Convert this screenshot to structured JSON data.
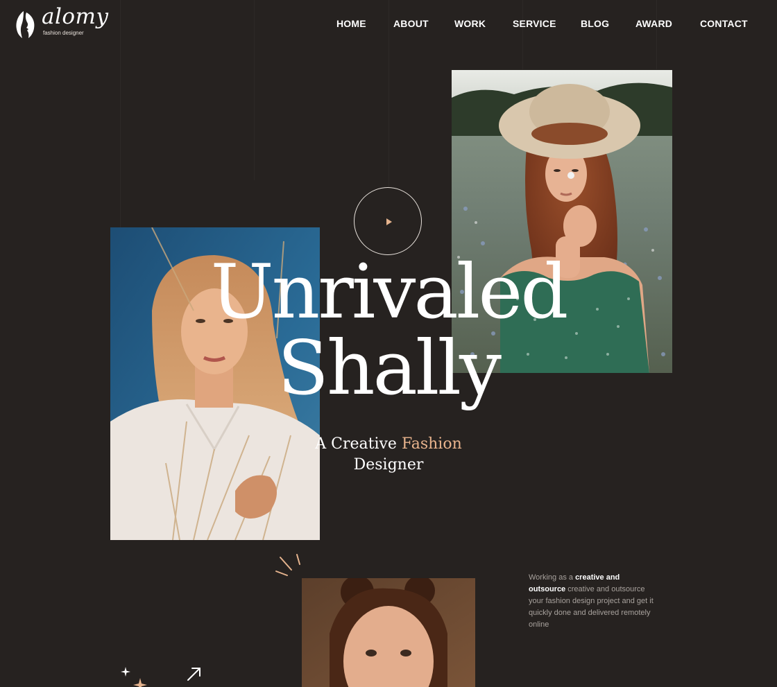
{
  "brand": {
    "name": "alomy",
    "tagline": "fashion designer"
  },
  "nav": {
    "items": [
      {
        "label": "HOME"
      },
      {
        "label": "ABOUT"
      },
      {
        "label": "WORK"
      },
      {
        "label": "SERVICE"
      },
      {
        "label": "BLOG"
      },
      {
        "label": "AWARD"
      },
      {
        "label": "CONTACT"
      }
    ]
  },
  "hero": {
    "title_line1": "Unrivaled",
    "title_line2": "Shally",
    "subtitle_part1": "A Creative ",
    "subtitle_accent": "Fashion",
    "subtitle_part2": "Designer"
  },
  "about": {
    "intro": "Working as a ",
    "highlight": "creative and outsource",
    "rest": " creative and outsource your fashion design project and get it quickly done and delivered remotely online"
  },
  "colors": {
    "background": "#262220",
    "accent": "#e9b48d",
    "text": "#ffffff",
    "muted_text": "#a8a29d"
  },
  "icons": {
    "logo": "woman-profile-logo-icon",
    "play": "play-icon",
    "sparkle": "sparkle-icon",
    "arrow": "arrow-up-right-icon",
    "burst": "burst-lines-icon"
  }
}
